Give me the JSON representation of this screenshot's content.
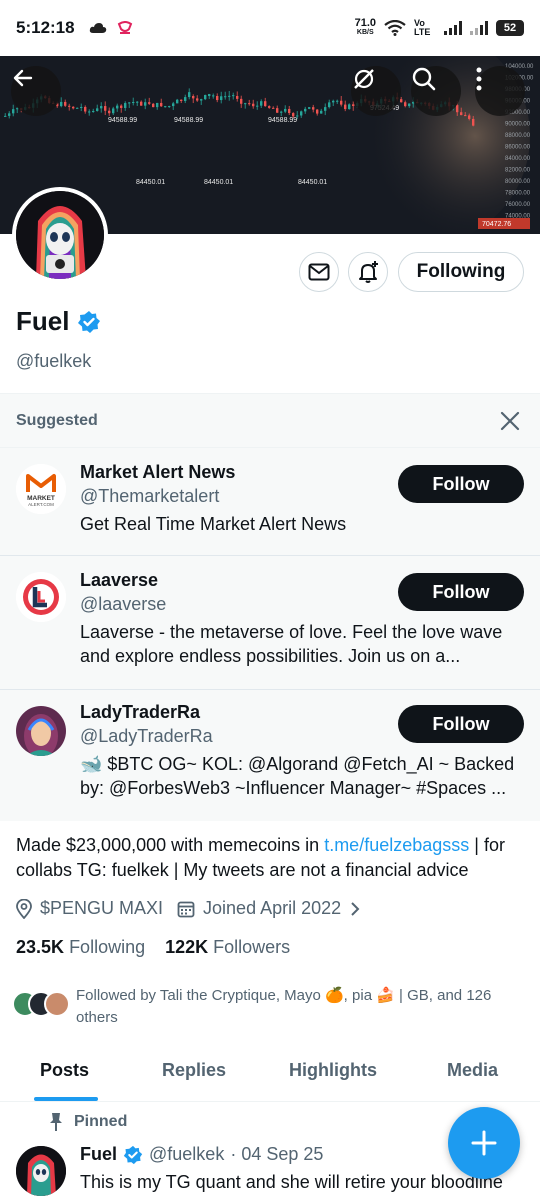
{
  "status_bar": {
    "time": "5:12:18",
    "net_speed": "71.0",
    "net_unit": "KB/S",
    "carrier": "Vo LTE",
    "battery": "52"
  },
  "banner": {
    "price_labels": [
      "94588.99",
      "94588.99",
      "94588.99",
      "97524.49",
      "84450.01",
      "84450.01",
      "84450.01"
    ],
    "price_ticks": [
      "104000.00",
      "102000.00",
      "98000.00",
      "96000.00",
      "92000.00",
      "90000.00",
      "88000.00",
      "86000.00",
      "84000.00",
      "82000.00",
      "80000.00",
      "78000.00",
      "76000.00",
      "74000.00"
    ],
    "current_price": "70472.76"
  },
  "profile": {
    "name": "Fuel",
    "handle": "@fuelkek",
    "following_button": "Following"
  },
  "suggested": {
    "title": "Suggested",
    "items": [
      {
        "name": "Market Alert News",
        "handle": "@Themarketalert",
        "bio": "Get Real Time Market Alert News",
        "button": "Follow",
        "logo_text": "MARKET ALERT.COM"
      },
      {
        "name": "Laaverse",
        "handle": "@laaverse",
        "bio": "Laaverse - the metaverse of love. Feel the love wave and explore endless possibilities. Join us on a...",
        "button": "Follow"
      },
      {
        "name": "LadyTraderRa",
        "handle": "@LadyTraderRa",
        "bio": "🐋 $BTC OG~ KOL: @Algorand @Fetch_AI ~ Backed by: @ForbesWeb3 ~Influencer Manager~ #Spaces ...",
        "button": "Follow"
      }
    ]
  },
  "bio": {
    "text_before": "Made $23,000,000 with memecoins in ",
    "link": "t.me/fuelzebagsss",
    "text_after": " | for collabs TG: fuelkek | My tweets are not a financial advice"
  },
  "meta": {
    "location": "$PENGU MAXI",
    "joined": "Joined April 2022"
  },
  "stats": {
    "following_count": "23.5K",
    "following_label": "Following",
    "followers_count": "122K",
    "followers_label": "Followers"
  },
  "followed_by": "Followed by Tali the Cryptique, Mayo 🍊, pia 🍰 | GB, and 126 others",
  "tabs": [
    "Posts",
    "Replies",
    "Highlights",
    "Media"
  ],
  "post": {
    "pinned_label": "Pinned",
    "author": "Fuel",
    "handle": "@fuelkek",
    "date": "· 04 Sep 25",
    "text": "This is my TG quant and she will retire your bloodline"
  },
  "colors": {
    "accent": "#1d9bf0",
    "text": "#0f1419",
    "muted": "#536471",
    "button_dark": "#0f1419"
  }
}
